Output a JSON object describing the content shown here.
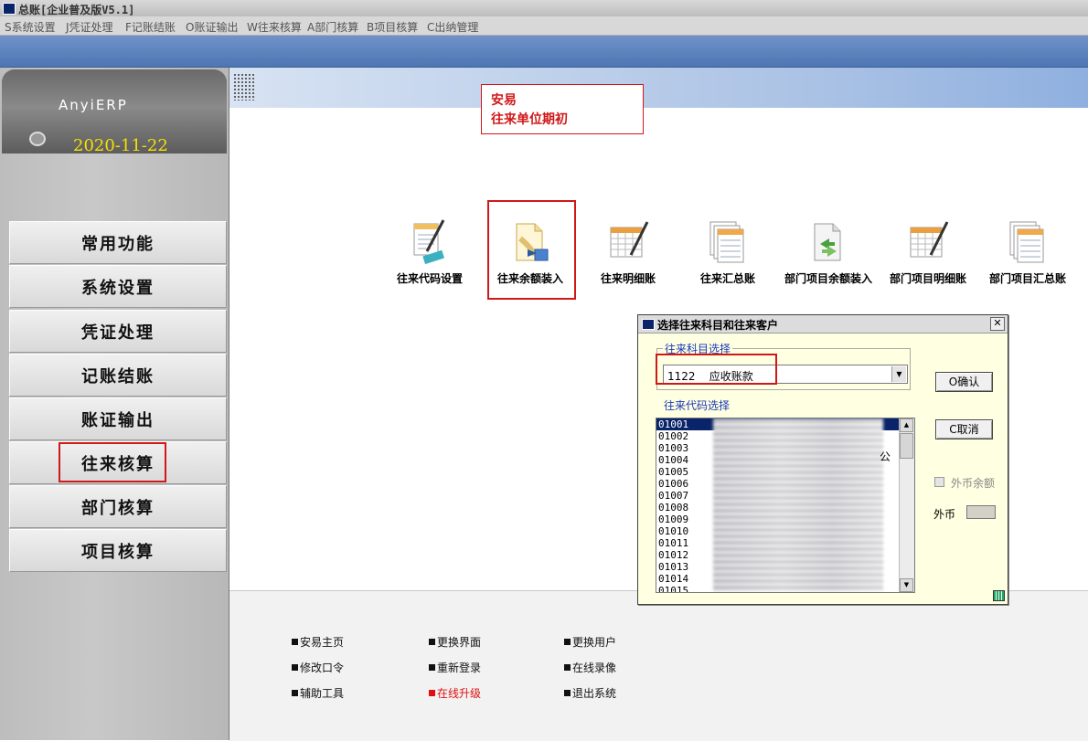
{
  "window": {
    "title": "总账[企业普及版V5.1]"
  },
  "menu": [
    {
      "label": "S系统设置"
    },
    {
      "label": "J凭证处理"
    },
    {
      "label": "F记账结账"
    },
    {
      "label": "O账证输出"
    },
    {
      "label": "W往来核算"
    },
    {
      "label": "A部门核算"
    },
    {
      "label": "B项目核算"
    },
    {
      "label": "C出纳管理"
    }
  ],
  "sidebar": {
    "brand": "AnyiERP",
    "date": "2020-11-22",
    "items": [
      {
        "label": "常用功能"
      },
      {
        "label": "系统设置"
      },
      {
        "label": "凭证处理"
      },
      {
        "label": "记账结账"
      },
      {
        "label": "账证输出"
      },
      {
        "label": "往来核算",
        "highlighted": true
      },
      {
        "label": "部门核算"
      },
      {
        "label": "项目核算"
      }
    ]
  },
  "module": {
    "line1": "安易",
    "line2": "往来单位期初"
  },
  "functions": [
    {
      "label": "往来代码设置",
      "icon": "code-setup-icon"
    },
    {
      "label": "往来余额装入",
      "icon": "balance-import-icon",
      "highlighted": true
    },
    {
      "label": "往来明细账",
      "icon": "detail-ledger-icon"
    },
    {
      "label": "往来汇总账",
      "icon": "summary-ledger-icon"
    },
    {
      "label": "部门项目余额装入",
      "icon": "dept-balance-import-icon"
    },
    {
      "label": "部门项目明细账",
      "icon": "dept-detail-ledger-icon"
    },
    {
      "label": "部门项目汇总账",
      "icon": "dept-summary-ledger-icon"
    }
  ],
  "footer_links": [
    {
      "label": "安易主页"
    },
    {
      "label": "更换界面"
    },
    {
      "label": "更换用户"
    },
    {
      "label": "修改口令"
    },
    {
      "label": "重新登录"
    },
    {
      "label": "在线录像"
    },
    {
      "label": "辅助工具"
    },
    {
      "label": "在线升级",
      "color": "#e01010"
    },
    {
      "label": "退出系统"
    }
  ],
  "dialog": {
    "title": "选择往来科目和往来客户",
    "subject_group_label": "往来科目选择",
    "subject_value": "1122    应收账款",
    "code_group_label": "往来代码选择",
    "codes": [
      "01001",
      "01002",
      "01003",
      "01004",
      "01005",
      "01006",
      "01007",
      "01008",
      "01009",
      "01010",
      "01011",
      "01012",
      "01013",
      "01014",
      "01015"
    ],
    "selected_code": "01001",
    "visible_tail_text": "公",
    "ok_label": "O确认",
    "cancel_label": "C取消",
    "fx_balance_label": "外币余额",
    "fx_label": "外币",
    "close_label": "✕"
  },
  "colors": {
    "highlight": "#d01818",
    "dialog_bg": "#ffffe1",
    "group_label": "#1a3ab8",
    "selection": "#0a246a"
  }
}
